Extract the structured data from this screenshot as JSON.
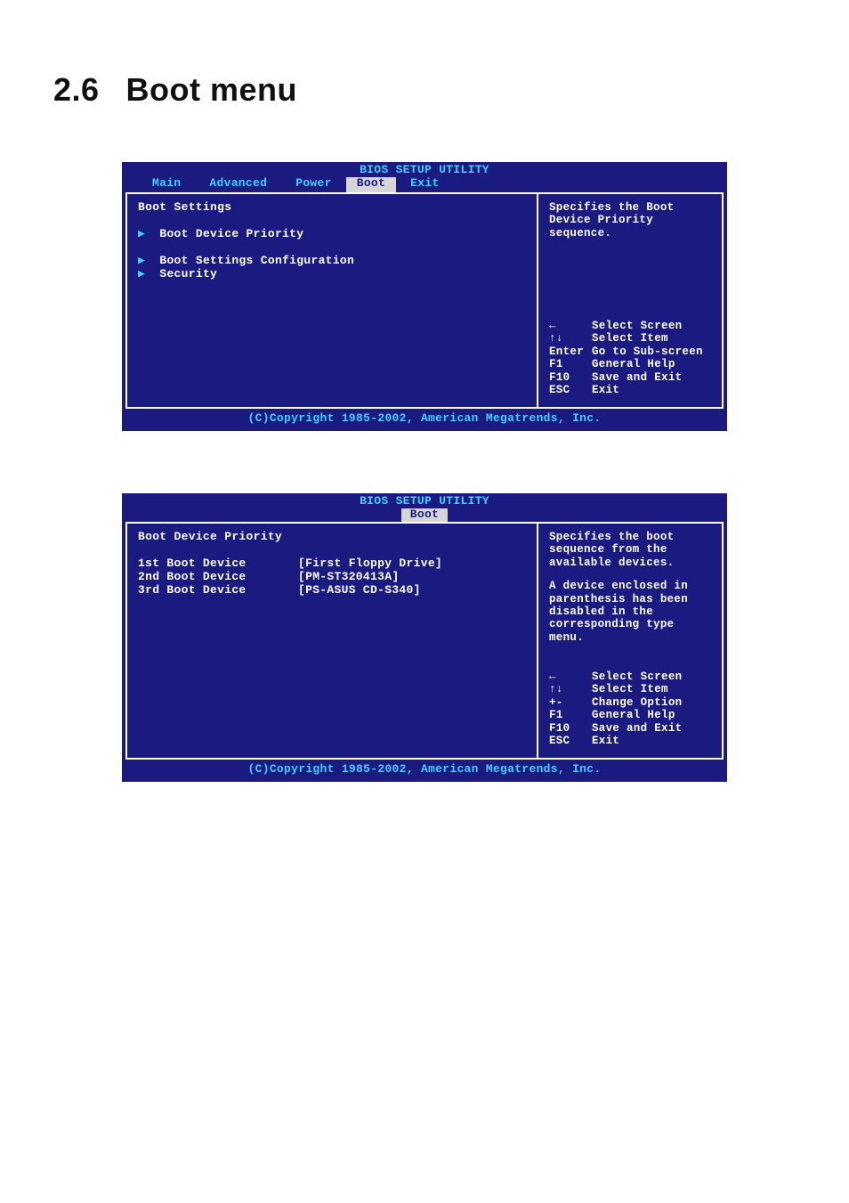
{
  "heading": {
    "num": "2.6",
    "title": "Boot menu"
  },
  "bios_title": "BIOS SETUP UTILITY",
  "tabs": {
    "main": "Main",
    "advanced": "Advanced",
    "power": "Power",
    "boot": "Boot",
    "exit": "Exit"
  },
  "screen1": {
    "heading": "Boot Settings",
    "items": [
      "Boot Device Priority",
      "Boot Settings Configuration",
      "Security"
    ],
    "help_text": "Specifies the Boot Device Priority sequence.",
    "help_keys": [
      {
        "sym": "←",
        "label": "Select Screen"
      },
      {
        "sym": "↑↓",
        "label": "Select Item"
      },
      {
        "sym": "Enter",
        "label": "Go to Sub-screen"
      },
      {
        "sym": "F1",
        "label": "General Help"
      },
      {
        "sym": "F10",
        "label": "Save and Exit"
      },
      {
        "sym": "ESC",
        "label": "Exit"
      }
    ]
  },
  "screen2": {
    "heading": "Boot Device Priority",
    "rows": [
      {
        "label": "1st Boot Device",
        "value": "[First Floppy Drive]"
      },
      {
        "label": "2nd Boot Device",
        "value": "[PM-ST320413A]"
      },
      {
        "label": "3rd Boot Device",
        "value": "[PS-ASUS CD-S340]"
      }
    ],
    "help_text1": "Specifies the boot sequence from the available devices.",
    "help_text2": "A device enclosed in parenthesis has been disabled in the corresponding type menu.",
    "help_keys": [
      {
        "sym": "←",
        "label": "Select Screen"
      },
      {
        "sym": "↑↓",
        "label": "Select Item"
      },
      {
        "sym": "+-",
        "label": "Change Option"
      },
      {
        "sym": "F1",
        "label": "General Help"
      },
      {
        "sym": "F10",
        "label": "Save and Exit"
      },
      {
        "sym": "ESC",
        "label": "Exit"
      }
    ]
  },
  "copyright": "(C)Copyright 1985-2002, American Megatrends, Inc."
}
